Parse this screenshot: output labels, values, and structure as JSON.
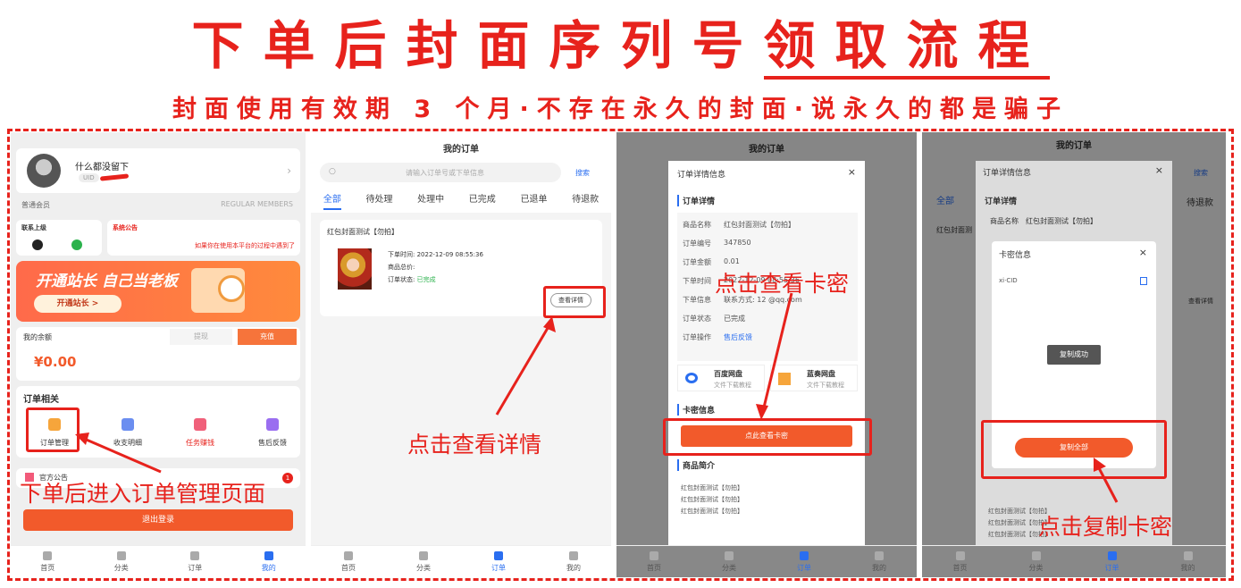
{
  "title": {
    "main": "下单后封面序列号",
    "underlined": "领取流程"
  },
  "subtitle": "封面使用有效期 3 个月·不存在永久的封面·说永久的都是骗子",
  "annotations": {
    "step1": "下单后进入订单管理页面",
    "step2": "点击查看详情",
    "step3": "点击查看卡密",
    "step4": "点击复制卡密"
  },
  "tabbar": {
    "home": "首页",
    "category": "分类",
    "orders": "订单",
    "mine": "我的"
  },
  "screen1": {
    "username": "什么都没留下",
    "uid_label": "UID",
    "member_label": "普通会员",
    "member_en": "REGULAR MEMBERS",
    "contact_title": "联系上级",
    "notice_title": "系统公告",
    "notice_text": "如果你在使用本平台的过程中遇到了",
    "banner_title": "开通站长 自己当老板",
    "banner_button": "开通站长 >",
    "balance_label": "我的余额",
    "withdraw": "提现",
    "recharge": "充值",
    "balance_value": "¥0.00",
    "order_section": "订单相关",
    "menu": [
      "订单管理",
      "收支明细",
      "任务赚钱",
      "售后反馈"
    ],
    "notice_bar": "官方公告",
    "notice_badge": "1",
    "logout": "退出登录"
  },
  "screen2": {
    "page_title": "我的订单",
    "search_placeholder": "请输入订单号或下单信息",
    "search_button": "搜索",
    "tabs": [
      "全部",
      "待处理",
      "处理中",
      "已完成",
      "已退单",
      "待退款"
    ],
    "product_name": "红包封面测试【勿拍】",
    "order_time_label": "下单时间:",
    "order_time": "2022-12-09 08:55:36",
    "total_label": "商品总价:",
    "status_label": "订单状态:",
    "status": "已完成",
    "detail_button": "查看详情"
  },
  "screen3": {
    "modal_title": "订单详情信息",
    "section_detail": "订单详情",
    "rows": [
      {
        "k": "商品名称",
        "v": "红包封面测试【勿拍】"
      },
      {
        "k": "订单编号",
        "v": "347850"
      },
      {
        "k": "订单金额",
        "v": "0.01"
      },
      {
        "k": "下单时间",
        "v": "2022-12-09 08:55:36"
      },
      {
        "k": "下单信息",
        "v": "联系方式: 12 @qq.com"
      },
      {
        "k": "订单状态",
        "v": "已完成"
      },
      {
        "k": "订单操作",
        "v": "售后反馈"
      }
    ],
    "pan1": "百度网盘",
    "pan2": "蓝奏网盘",
    "pan_sub": "文件下载教程",
    "section_card": "卡密信息",
    "card_button": "点此查看卡密",
    "section_intro": "商品简介",
    "intro_lines": [
      "红包封面测试【勿拍】",
      "红包封面测试【勿拍】",
      "红包封面测试【勿拍】"
    ]
  },
  "screen4": {
    "modal_title": "订单详情信息",
    "section_detail": "订单详情",
    "product_label": "商品名称",
    "product_value": "红包封面测试【勿拍】",
    "card_title": "卡密信息",
    "card_value": "xi·CID",
    "toast": "复制成功",
    "copy_button": "复制全部",
    "intro_lines": [
      "红包封面测试【勿拍】",
      "红包封面测试【勿拍】",
      "红包封面测试【勿拍】"
    ],
    "bg_right_tab": "待退款",
    "bg_search": "搜索",
    "bg_detail": "查看详情",
    "bg_tab_all": "全部",
    "bg_product": "红包封面测"
  },
  "colors": {
    "accent": "#e7221c",
    "blue": "#2a6ef0",
    "orange": "#f25a2b"
  }
}
